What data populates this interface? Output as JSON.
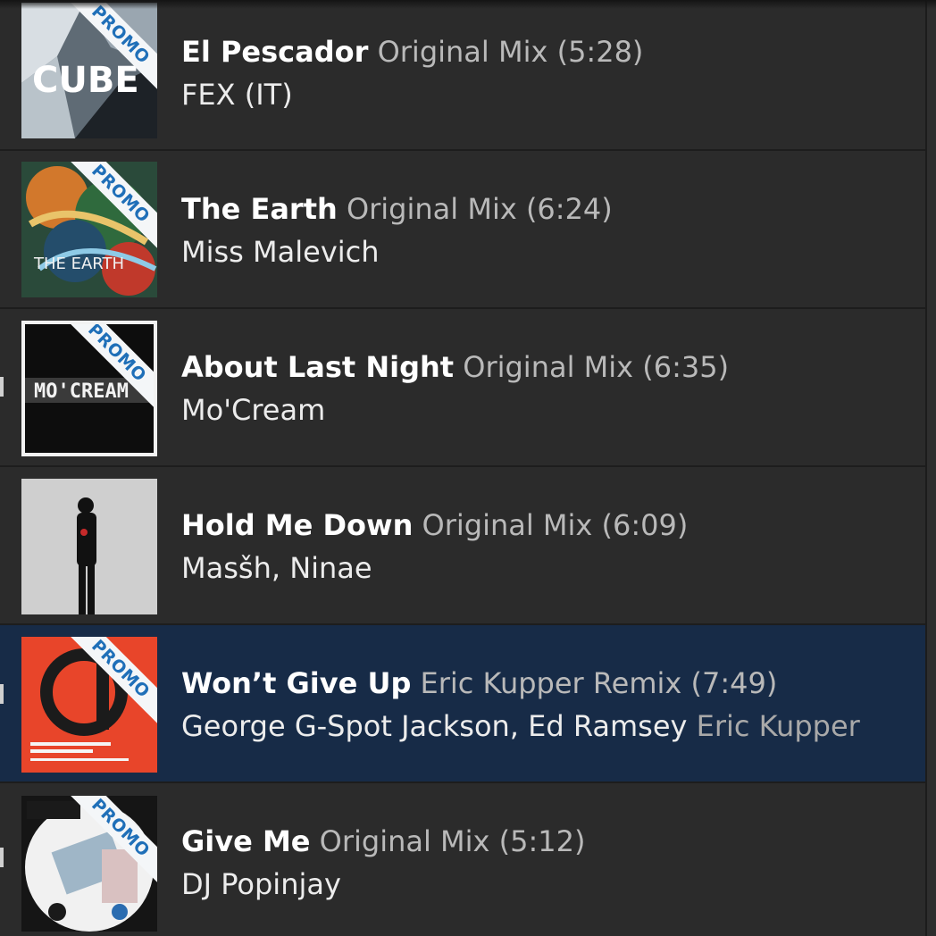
{
  "tracks": [
    {
      "title": "El Pescador",
      "mix": "Original Mix (5:28)",
      "artists": "FEX (IT)",
      "remixer": "",
      "promo": true,
      "art_colors": [
        "#8b98a4",
        "#e8eef2",
        "#1d2227"
      ]
    },
    {
      "title": "The Earth",
      "mix": "Original Mix (6:24)",
      "artists": "Miss Malevich",
      "remixer": "",
      "promo": true,
      "art_colors": [
        "#2f6a3d",
        "#d2782c",
        "#244d6b"
      ]
    },
    {
      "title": "About Last Night",
      "mix": "Original Mix (6:35)",
      "artists": "Mo'Cream",
      "remixer": "",
      "promo": true,
      "art_colors": [
        "#0d0d0d",
        "#f2f2f2",
        "#3a3a3a"
      ]
    },
    {
      "title": "Hold Me Down",
      "mix": "Original Mix (6:09)",
      "artists": "Masšh, Ninae",
      "remixer": "",
      "promo": false,
      "art_colors": [
        "#c9c9c9",
        "#111111",
        "#c62a2a"
      ]
    },
    {
      "title": "Won’t Give Up",
      "mix": "Eric Kupper Remix (7:49)",
      "artists": "George G-Spot Jackson, Ed Ramsey",
      "remixer": "Eric Kupper",
      "promo": true,
      "selected": true,
      "art_colors": [
        "#e8452a",
        "#1b1b1b",
        "#f5f5f5"
      ]
    },
    {
      "title": "Give Me",
      "mix": "Original Mix (5:12)",
      "artists": "DJ Popinjay",
      "remixer": "",
      "promo": true,
      "art_colors": [
        "#f1f1f1",
        "#1a1a1a",
        "#9fb6c7"
      ]
    }
  ],
  "promo_label": "PROMO",
  "art_text": {
    "t0": "CUBE",
    "t1": "THE EARTH",
    "t2": "MO'CREAM"
  },
  "colors": {
    "row_bg": "#2b2b2b",
    "selected_bg": "#172b47",
    "promo_text": "#1f6fb8"
  }
}
